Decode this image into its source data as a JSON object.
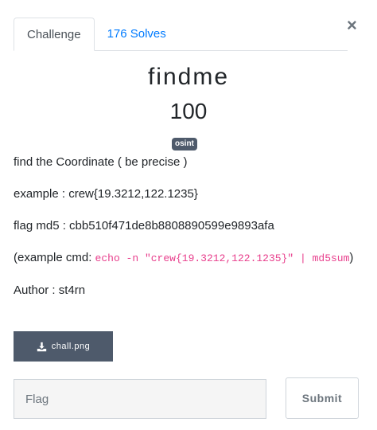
{
  "modal": {
    "close_symbol": "×"
  },
  "tabs": [
    {
      "label": "Challenge",
      "active": true
    },
    {
      "label": "176 Solves",
      "active": false
    }
  ],
  "challenge": {
    "name": "findme",
    "value": "100",
    "tag": "osint",
    "description": {
      "line1": "find the Coordinate ( be precise )",
      "line2": "example : crew{19.3212,122.1235}",
      "line3": "flag md5 : cbb510f471de8b8808890599e9893afa",
      "example_prefix": "(example cmd: ",
      "example_code": "echo -n \"crew{19.3212,122.1235}\" | md5sum",
      "example_suffix": ")",
      "author": "Author : st4rn"
    },
    "file": {
      "label": "chall.png",
      "icon": "download-icon"
    }
  },
  "submission": {
    "placeholder": "Flag",
    "submit_label": "Submit"
  }
}
